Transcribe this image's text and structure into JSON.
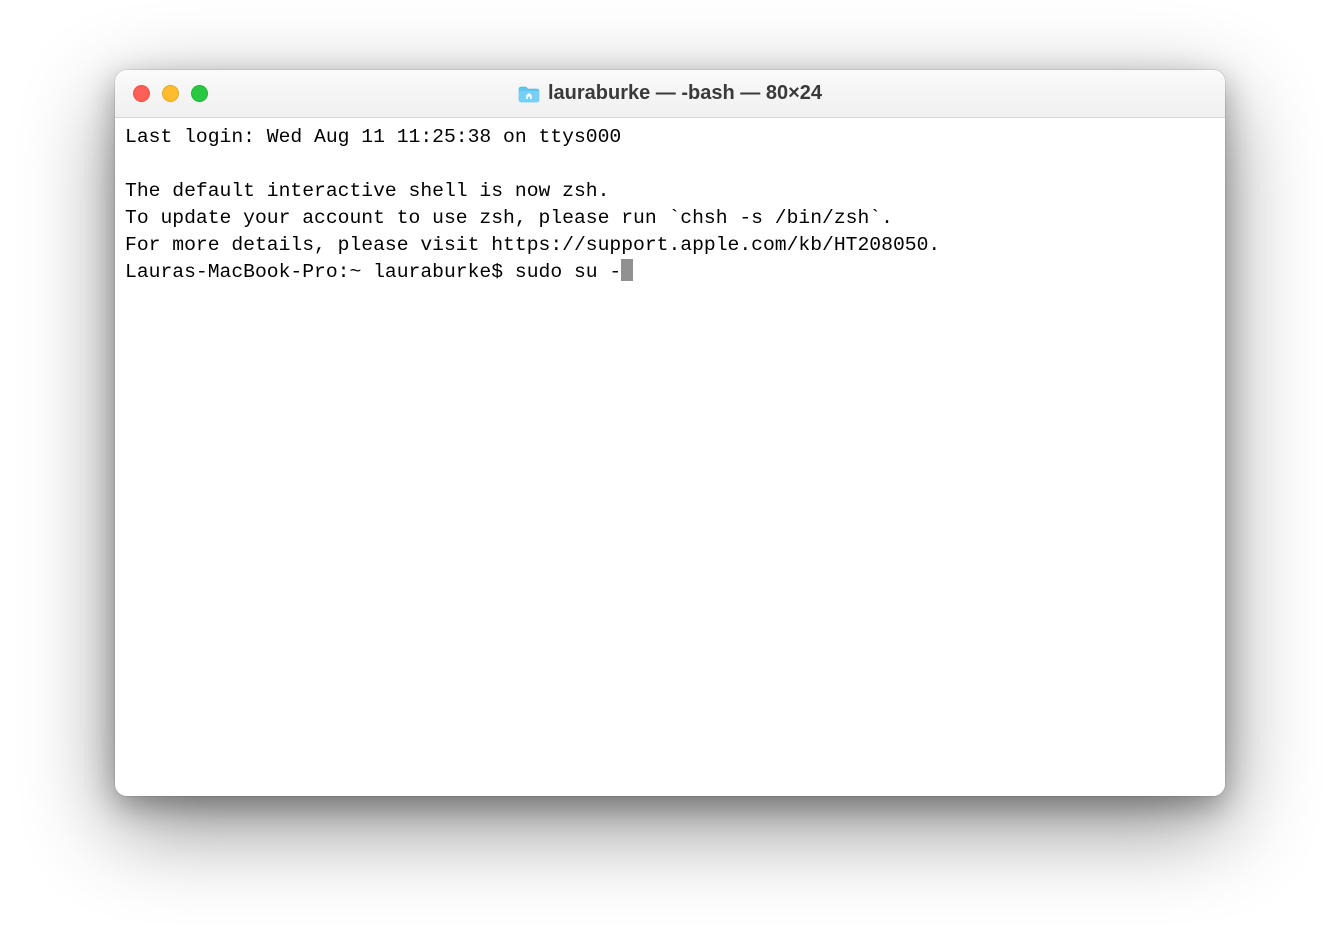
{
  "window": {
    "title": "lauraburke — -bash — 80×24"
  },
  "terminal": {
    "lines": [
      "Last login: Wed Aug 11 11:25:38 on ttys000",
      "",
      "The default interactive shell is now zsh.",
      "To update your account to use zsh, please run `chsh -s /bin/zsh`.",
      "For more details, please visit https://support.apple.com/kb/HT208050."
    ],
    "prompt": "Lauras-MacBook-Pro:~ lauraburke$ ",
    "command": "sudo su -"
  }
}
